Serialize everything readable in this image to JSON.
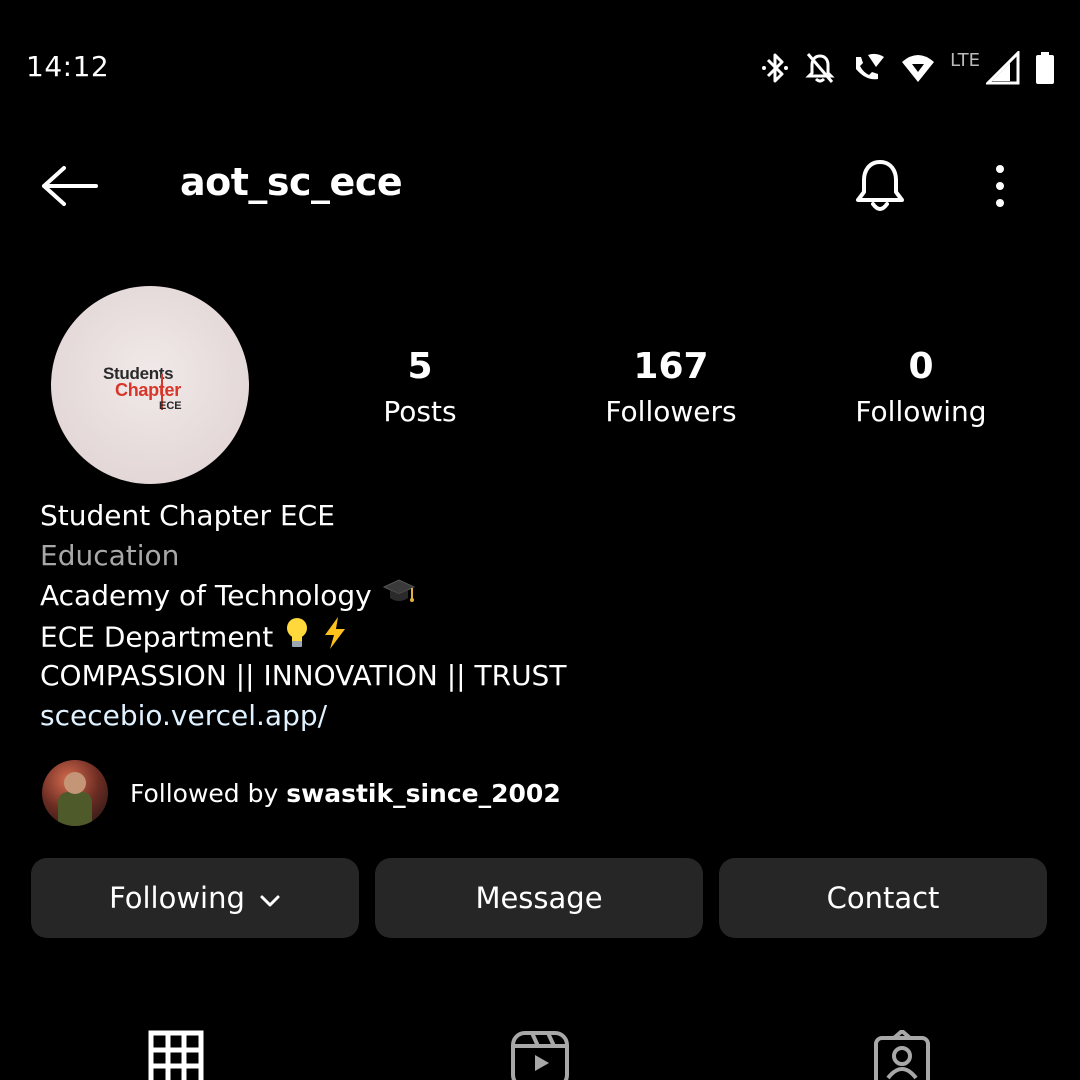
{
  "status_bar": {
    "time": "14:12",
    "network": "LTE",
    "icons": [
      "bluetooth-icon",
      "notifications-off-icon",
      "wifi-calling-icon",
      "wifi-icon",
      "cell-signal-icon",
      "battery-icon"
    ]
  },
  "header": {
    "username": "aot_sc_ece",
    "back_icon": "arrow-left-icon",
    "bell_icon": "bell-icon",
    "more_icon": "more-vertical-icon"
  },
  "profile": {
    "avatar_logo": {
      "line1": "Students",
      "line2": "Chapter",
      "line3": "ECE"
    },
    "stats": {
      "posts": {
        "value": "5",
        "label": "Posts"
      },
      "followers": {
        "value": "167",
        "label": "Followers"
      },
      "following": {
        "value": "0",
        "label": "Following"
      }
    }
  },
  "bio": {
    "name": "Student Chapter ECE",
    "category": "Education",
    "line1": "Academy of Technology",
    "line2": "ECE Department",
    "line3": "COMPASSION || INNOVATION || TRUST",
    "link": "scecebio.vercel.app/",
    "line1_emoji": "graduation-cap-icon",
    "line2_emojis": [
      "light-bulb-icon",
      "lightning-icon"
    ]
  },
  "followed_by": {
    "prefix": "Followed by",
    "user": "swastik_since_2002"
  },
  "actions": {
    "following": "Following",
    "message": "Message",
    "contact": "Contact"
  },
  "tabs": [
    "grid-icon",
    "reels-icon",
    "tagged-icon"
  ],
  "colors": {
    "background": "#000000",
    "button": "#262626",
    "category_text": "#a8a8a8",
    "link_text": "#e0f1ff"
  }
}
